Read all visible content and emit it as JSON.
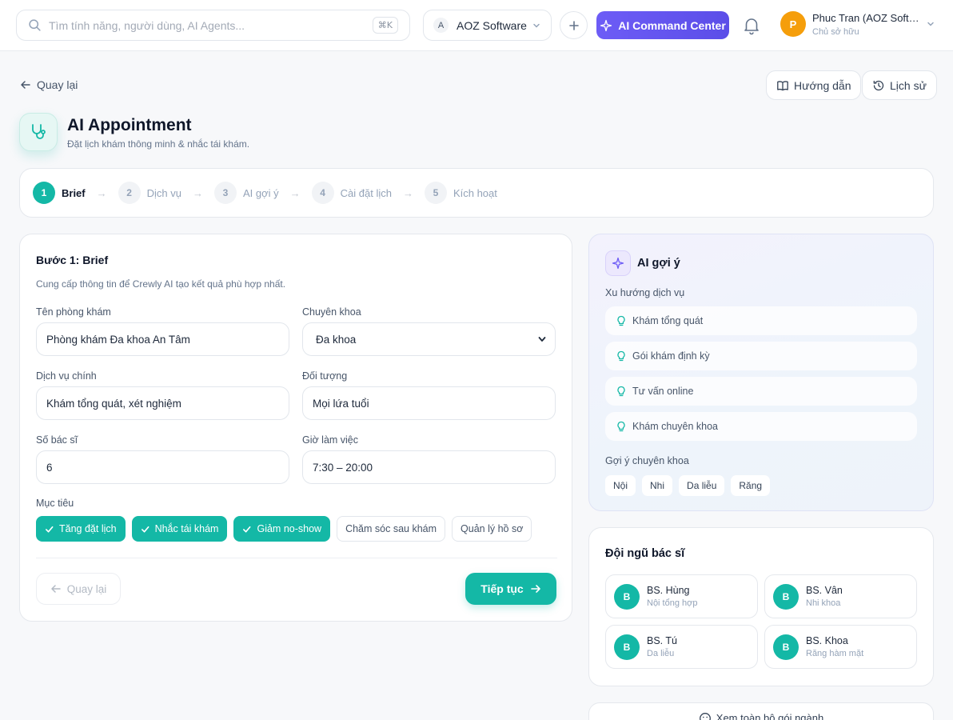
{
  "topbar": {
    "search_placeholder": "Tìm tính năng, người dùng, AI Agents...",
    "search_shortcut": "⌘K",
    "org_initial": "A",
    "org_name": "AOZ Software",
    "ai_command_label": "AI Command Center",
    "user_initial": "P",
    "user_name": "Phuc Tran (AOZ Software)",
    "user_role": "Chủ sở hữu"
  },
  "header": {
    "back_label": "Quay lại",
    "guide_label": "Hướng dẫn",
    "history_label": "Lịch sử",
    "title": "AI Appointment",
    "subtitle": "Đặt lịch khám thông minh & nhắc tái khám."
  },
  "steps": [
    {
      "num": "1",
      "label": "Brief",
      "active": true
    },
    {
      "num": "2",
      "label": "Dịch vụ",
      "active": false
    },
    {
      "num": "3",
      "label": "AI gợi ý",
      "active": false
    },
    {
      "num": "4",
      "label": "Cài đặt lịch",
      "active": false
    },
    {
      "num": "5",
      "label": "Kích hoạt",
      "active": false
    }
  ],
  "form": {
    "title": "Bước 1: Brief",
    "description": "Cung cấp thông tin để Crewly AI tạo kết quả phù hợp nhất.",
    "fields": {
      "clinic_name": {
        "label": "Tên phòng khám",
        "value": "Phòng khám Đa khoa An Tâm"
      },
      "specialty": {
        "label": "Chuyên khoa",
        "value": "Đa khoa"
      },
      "main_service": {
        "label": "Dịch vụ chính",
        "value": "Khám tổng quát, xét nghiệm"
      },
      "audience": {
        "label": "Đối tượng",
        "value": "Mọi lứa tuổi"
      },
      "doctor_count": {
        "label": "Số bác sĩ",
        "value": "6"
      },
      "work_hours": {
        "label": "Giờ làm việc",
        "value": "7:30 – 20:00"
      }
    },
    "goals_label": "Mục tiêu",
    "goals": [
      {
        "label": "Tăng đặt lịch",
        "selected": true
      },
      {
        "label": "Nhắc tái khám",
        "selected": true
      },
      {
        "label": "Giảm no-show",
        "selected": true
      },
      {
        "label": "Chăm sóc sau khám",
        "selected": false
      },
      {
        "label": "Quản lý hồ sơ",
        "selected": false
      }
    ],
    "back_label": "Quay lại",
    "next_label": "Tiếp tục"
  },
  "ai_panel": {
    "title": "AI gợi ý",
    "trends_label": "Xu hướng dịch vụ",
    "trends": [
      "Khám tổng quát",
      "Gói khám định kỳ",
      "Tư vấn online",
      "Khám chuyên khoa"
    ],
    "specialty_label": "Gợi ý chuyên khoa",
    "specialties": [
      "Nội",
      "Nhi",
      "Da liễu",
      "Răng"
    ]
  },
  "doctors": {
    "title": "Đội ngũ bác sĩ",
    "list": [
      {
        "initial": "B",
        "name": "BS. Hùng",
        "specialty": "Nội tổng hợp"
      },
      {
        "initial": "B",
        "name": "BS. Vân",
        "specialty": "Nhi khoa"
      },
      {
        "initial": "B",
        "name": "BS. Tú",
        "specialty": "Da liễu"
      },
      {
        "initial": "B",
        "name": "BS. Khoa",
        "specialty": "Răng hàm mặt"
      }
    ]
  },
  "more": {
    "label": "Xem toàn bộ gói ngành"
  },
  "colors": {
    "accent": "#14b8a6",
    "ai_purple": "#5b4ee8",
    "avatar_orange": "#f59e0b"
  }
}
